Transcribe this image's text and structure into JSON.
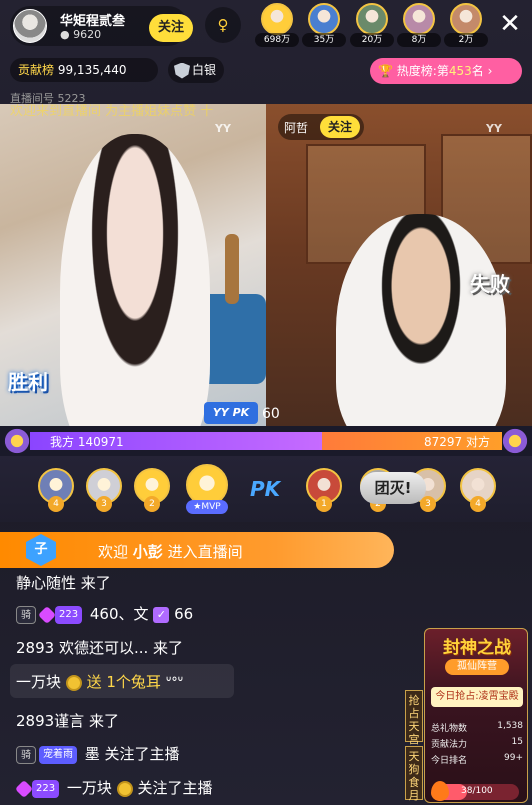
{
  "host": {
    "name": "华矩程贰叁",
    "fans": "9620",
    "follow_label": "关注"
  },
  "audience": [
    {
      "count": "698万",
      "color": "#ffcd3a"
    },
    {
      "count": "35万",
      "color": "#4a7fd0"
    },
    {
      "count": "20万",
      "color": "#6a8a6a"
    },
    {
      "count": "8万",
      "color": "#b88aa8"
    },
    {
      "count": "2万",
      "color": "#c48a6a"
    }
  ],
  "close_label": "✕",
  "contribution": {
    "label": "贡献榜",
    "value": "99,135,440"
  },
  "rank_badge": "白银",
  "heat": {
    "label": "热度榜:第",
    "num": "453",
    "suffix": "名",
    "arrow": "›"
  },
  "room_id": "直播间号 5223",
  "ticker": "欢迎来到直播间 为主播姐妹点赞 十",
  "opponent": {
    "name": "阿哲",
    "follow_label": "关注"
  },
  "watermark": "YY",
  "win_label": "胜利",
  "lose_label": "失败",
  "pk_logo": "YY PK",
  "timer": "60",
  "pk": {
    "left_label": "我方",
    "left_score": "140971",
    "right_label": "对方",
    "right_score": "87297",
    "left_share": 0.6176
  },
  "left_contributors": [
    {
      "rank": "4",
      "color": "#6f7fb6"
    },
    {
      "rank": "3",
      "color": "#cfcfd6"
    },
    {
      "rank": "2",
      "color": "#ffcd3a"
    },
    {
      "rank": "1",
      "color": "#ffcd3a"
    }
  ],
  "mvp_label": "★MVP",
  "pk_text": "PK",
  "right_contributors": [
    {
      "rank": "1",
      "color": "#c84a3a"
    },
    {
      "rank": "2",
      "color": "#aaaaaa"
    },
    {
      "rank": "3",
      "color": "#d8c0a8"
    },
    {
      "rank": "4",
      "color": "#e6d4c6"
    }
  ],
  "wipe_label": "团灭!",
  "welcome": {
    "badge": "子",
    "prefix": "欢迎",
    "name": "小彭",
    "suffix": "进入直播间"
  },
  "chat": {
    "line1": "静心随性 来了",
    "line2_level": "骑",
    "line2_lv": "223",
    "line2_text": "460、文",
    "line2_num": "66",
    "line3": "2893 欢德还可以... 来了",
    "gift_user": "一万块",
    "gift_text": "送 1个兔耳",
    "line5": "2893谨言 来了",
    "line6_level": "骑",
    "line6_tag": "宠着雨",
    "line6_text": "墨 关注了主播",
    "line7_lv": "223",
    "line7_user": "一万块",
    "line7_text": "关注了主播"
  },
  "side_tabs": [
    "抢占天宫",
    "天狗食月"
  ],
  "event": {
    "title": "封神之战",
    "subtitle": "孤仙阵营",
    "today": "今日抢占:凌霄宝殿",
    "gift_label": "总礼物数",
    "gift_value": "1,538",
    "power_label": "贡献法力",
    "power_value": "15",
    "rank_label": "今日排名",
    "rank_value": "99+",
    "progress_text": "38/100",
    "progress": 0.38
  }
}
